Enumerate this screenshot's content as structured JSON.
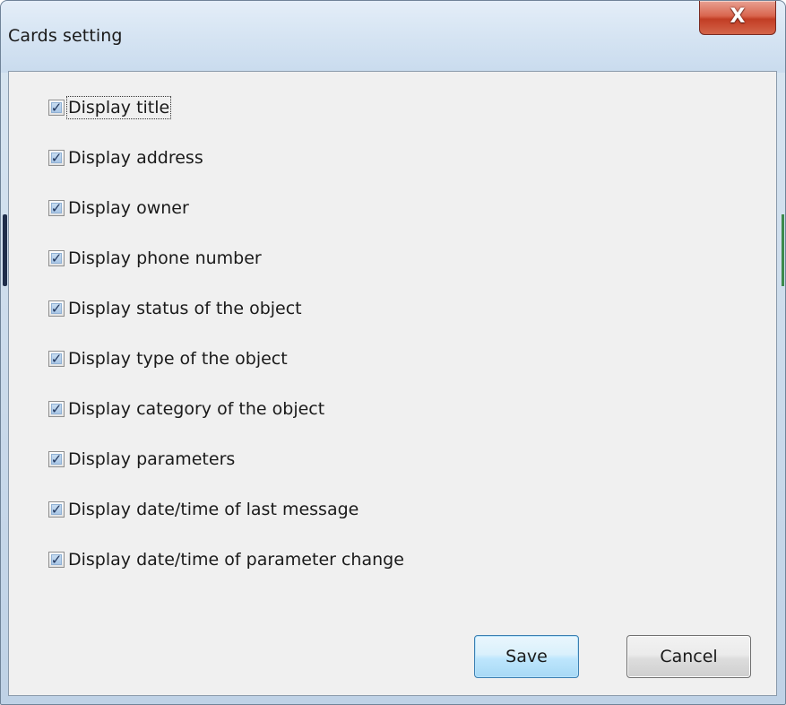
{
  "window": {
    "title": "Cards setting",
    "close_glyph": "X"
  },
  "options": [
    {
      "label": "Display title",
      "checked": true
    },
    {
      "label": "Display address",
      "checked": true
    },
    {
      "label": "Display owner",
      "checked": true
    },
    {
      "label": "Display phone number",
      "checked": true
    },
    {
      "label": "Display status of the object",
      "checked": true
    },
    {
      "label": "Display type of the object",
      "checked": true
    },
    {
      "label": "Display category of the object",
      "checked": true
    },
    {
      "label": "Display parameters",
      "checked": true
    },
    {
      "label": "Display date/time of last message",
      "checked": true
    },
    {
      "label": "Display date/time of parameter change",
      "checked": true
    }
  ],
  "check_glyph": "✓",
  "buttons": {
    "save_label": "Save",
    "cancel_label": "Cancel"
  },
  "colors": {
    "client_background": "#f0f0f0",
    "close_button": "#c23d24",
    "default_button_border": "#3c7fb1"
  }
}
